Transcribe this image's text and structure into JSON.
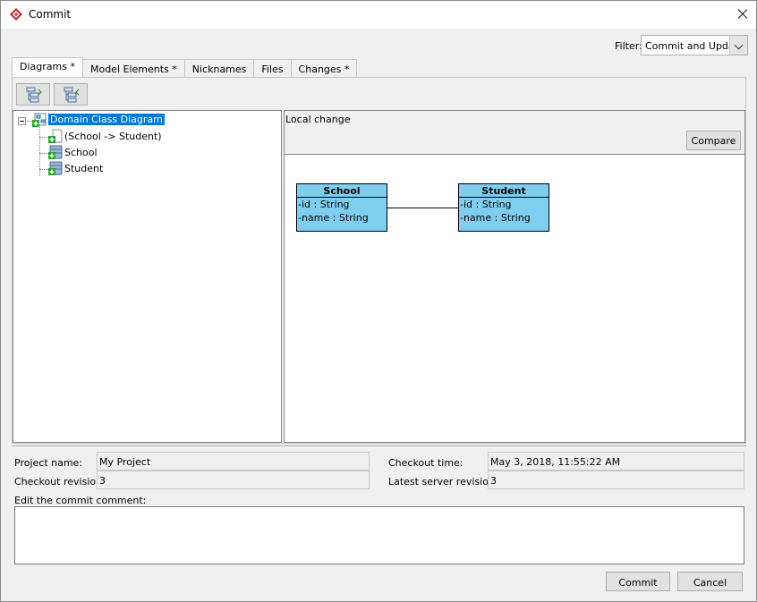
{
  "window": {
    "title": "Commit",
    "title_icon": "visual-paradigm-logo-icon"
  },
  "filter": {
    "label": "Filter:",
    "value": "Commit and Update"
  },
  "tabs": [
    {
      "label": "Diagrams *",
      "active": true
    },
    {
      "label": "Model Elements *",
      "active": false
    },
    {
      "label": "Nicknames",
      "active": false
    },
    {
      "label": "Files",
      "active": false
    },
    {
      "label": "Changes *",
      "active": false
    }
  ],
  "toolbar": {
    "expand_icon": "expand-all-icon",
    "collapse_icon": "collapse-all-icon"
  },
  "tree": {
    "root": {
      "label": "Domain Class Diagram",
      "icon": "class-diagram-added-icon"
    },
    "children": [
      {
        "label": "(School -> Student)",
        "icon": "association-added-icon"
      },
      {
        "label": "School",
        "icon": "class-added-icon"
      },
      {
        "label": "Student",
        "icon": "class-added-icon"
      }
    ]
  },
  "detail": {
    "heading": "Local change",
    "compare_label": "Compare",
    "classes": [
      {
        "name": "School",
        "attributes": [
          "-id : String",
          "-name : String"
        ]
      },
      {
        "name": "Student",
        "attributes": [
          "-id : String",
          "-name : String"
        ]
      }
    ],
    "class_fill_color": "#7fcef0"
  },
  "info": {
    "project_name_label": "Project name:",
    "project_name": "My Project",
    "checkout_revision_label": "Checkout revision:",
    "checkout_revision": "3",
    "checkout_time_label": "Checkout time:",
    "checkout_time": "May 3, 2018, 11:55:22 AM",
    "latest_server_revision_label": "Latest server revision:",
    "latest_server_revision": "3"
  },
  "comment": {
    "label": "Edit the commit comment:",
    "value": ""
  },
  "buttons": {
    "commit": "Commit",
    "cancel": "Cancel"
  }
}
